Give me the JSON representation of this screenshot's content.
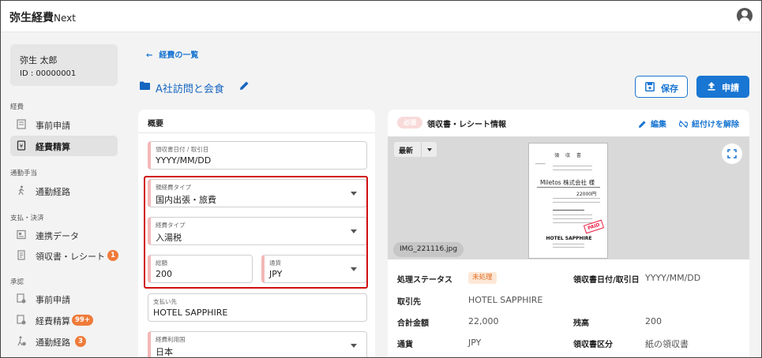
{
  "app": {
    "logo": "弥生経費",
    "logo_suffix": "Next"
  },
  "user": {
    "name": "弥生 太郎",
    "id": "ID : 00000001"
  },
  "sidebar": {
    "sections": [
      {
        "label": "経費",
        "items": [
          {
            "label": "事前申請",
            "icon": "document-icon"
          },
          {
            "label": "経費精算",
            "icon": "receipt-icon",
            "active": true
          }
        ]
      },
      {
        "label": "通勤手当",
        "items": [
          {
            "label": "通勤経路",
            "icon": "walk-icon"
          }
        ]
      },
      {
        "label": "支払・決済",
        "items": [
          {
            "label": "連携データ",
            "icon": "data-icon"
          },
          {
            "label": "領収書・レシート",
            "icon": "receipt-list-icon",
            "badge": "1"
          }
        ]
      },
      {
        "label": "承認",
        "items": [
          {
            "label": "事前申請",
            "icon": "approve-doc-icon"
          },
          {
            "label": "経費精算",
            "icon": "approve-expense-icon",
            "badge": "99+"
          },
          {
            "label": "通勤経路",
            "icon": "approve-route-icon",
            "badge": "3"
          }
        ]
      }
    ]
  },
  "main": {
    "back_link": "経費の一覧",
    "title": "A社訪問と会食",
    "save_label": "保存",
    "apply_label": "申請"
  },
  "form": {
    "card_title": "概要",
    "fields": {
      "receipt_date": {
        "label": "領収書日付 / 取引日",
        "value": "YYYY/MM/DD"
      },
      "parent_expense_type": {
        "label": "親経費タイプ",
        "value": "国内出張・旅費"
      },
      "expense_type": {
        "label": "経費タイプ",
        "value": "入湯税"
      },
      "amount": {
        "label": "総額",
        "value": "200"
      },
      "currency": {
        "label": "通貨",
        "value": "JPY"
      },
      "payee": {
        "label": "支払い先",
        "value": "HOTEL SAPPHIRE"
      },
      "country": {
        "label": "経費利用国",
        "value": "日本"
      }
    }
  },
  "receipt_panel": {
    "required_badge": "必須",
    "title": "領収書・レシート情報",
    "edit_label": "編集",
    "unlink_label": "紐付けを解除",
    "version_label": "最新",
    "file_name": "IMG_221116.jpg",
    "preview": {
      "title": "領 収 書",
      "company": "Miletos 株式会社",
      "company_suffix": "様",
      "amount": "22000円",
      "hotel": "HOTEL SAPPHIRE",
      "stamp": "PAID"
    },
    "info": {
      "status_label": "処理ステータス",
      "status_value": "未処理",
      "date_label": "領収書日付/取引日",
      "date_value": "YYYY/MM/DD",
      "vendor_label": "取引先",
      "vendor_value": "HOTEL SAPPHIRE",
      "total_label": "合計金額",
      "total_value": "22,000",
      "balance_label": "残高",
      "balance_value": "200",
      "currency_label": "通貨",
      "currency_value": "JPY",
      "type_label": "領収書区分",
      "type_value": "紙の領収書"
    }
  },
  "colors": {
    "accent": "#1976d2",
    "badge": "#ef7b3a",
    "highlight_border": "#d01010",
    "status": "#e06b1f"
  }
}
